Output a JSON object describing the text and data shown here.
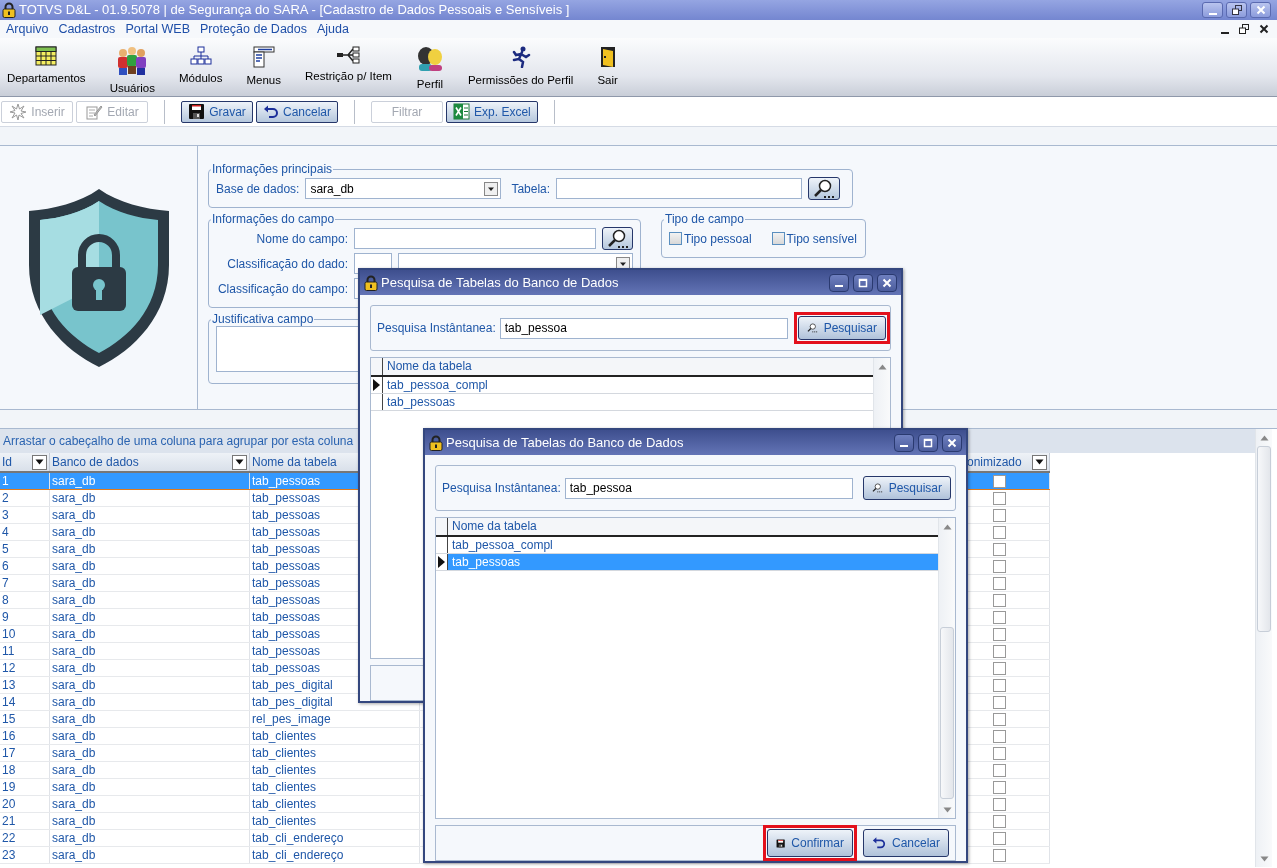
{
  "window": {
    "title": "TOTVS D&L - 01.9.5078 | de Segurança do SARA - [Cadastro de Dados Pessoais e Sensíveis ]"
  },
  "menu": [
    "Arquivo",
    "Cadastros",
    "Portal WEB",
    "Proteção de Dados",
    "Ajuda"
  ],
  "toolbar": [
    "Departamentos",
    "Usuários",
    "Módulos",
    "Menus",
    "Restrição p/ Item",
    "Perfil",
    "Permissões do Perfil",
    "Sair"
  ],
  "action_groups": [
    [
      {
        "label": "Inserir",
        "disabled": true
      },
      {
        "label": "Editar",
        "disabled": true
      }
    ],
    [
      {
        "label": "Gravar",
        "disabled": false
      },
      {
        "label": "Cancelar",
        "disabled": false
      }
    ],
    [
      {
        "label": "Filtrar",
        "disabled": true
      },
      {
        "label": "Exp. Excel",
        "disabled": false
      }
    ]
  ],
  "form": {
    "main": {
      "legend": "Informações principais",
      "database_label": "Base de dados:",
      "database_value": "sara_db",
      "table_label": "Tabela:"
    },
    "field": {
      "legend": "Informações do campo",
      "name_label": "Nome do campo:",
      "data_class_label": "Classificação do dado:",
      "field_class_label": "Classificação do campo:"
    },
    "type": {
      "legend": "Tipo de campo",
      "options": [
        {
          "label": "Tipo pessoal",
          "checked": false
        },
        {
          "label": "Tipo sensível",
          "checked": false
        }
      ]
    },
    "justification": {
      "legend": "Justificativa campo"
    }
  },
  "grid": {
    "group_hint": "Arrastar o cabeçalho de uma coluna para agrupar por esta coluna",
    "columns": [
      "Id",
      "Banco de dados",
      "Nome da tabela",
      "onimizado"
    ],
    "rows": [
      {
        "id": "1",
        "database": "sara_db",
        "table": "tab_pessoas",
        "anonymized": false,
        "selected": true
      },
      {
        "id": "2",
        "database": "sara_db",
        "table": "tab_pessoas",
        "anonymized": false,
        "selected": false
      },
      {
        "id": "3",
        "database": "sara_db",
        "table": "tab_pessoas",
        "anonymized": false,
        "selected": false
      },
      {
        "id": "4",
        "database": "sara_db",
        "table": "tab_pessoas",
        "anonymized": false,
        "selected": false
      },
      {
        "id": "5",
        "database": "sara_db",
        "table": "tab_pessoas",
        "anonymized": false,
        "selected": false
      },
      {
        "id": "6",
        "database": "sara_db",
        "table": "tab_pessoas",
        "anonymized": false,
        "selected": false
      },
      {
        "id": "7",
        "database": "sara_db",
        "table": "tab_pessoas",
        "anonymized": false,
        "selected": false
      },
      {
        "id": "8",
        "database": "sara_db",
        "table": "tab_pessoas",
        "anonymized": false,
        "selected": false
      },
      {
        "id": "9",
        "database": "sara_db",
        "table": "tab_pessoas",
        "anonymized": false,
        "selected": false
      },
      {
        "id": "10",
        "database": "sara_db",
        "table": "tab_pessoas",
        "anonymized": false,
        "selected": false
      },
      {
        "id": "11",
        "database": "sara_db",
        "table": "tab_pessoas",
        "anonymized": false,
        "selected": false
      },
      {
        "id": "12",
        "database": "sara_db",
        "table": "tab_pessoas",
        "anonymized": false,
        "selected": false
      },
      {
        "id": "13",
        "database": "sara_db",
        "table": "tab_pes_digital",
        "anonymized": false,
        "selected": false
      },
      {
        "id": "14",
        "database": "sara_db",
        "table": "tab_pes_digital",
        "anonymized": false,
        "selected": false
      },
      {
        "id": "15",
        "database": "sara_db",
        "table": "rel_pes_image",
        "anonymized": false,
        "selected": false
      },
      {
        "id": "16",
        "database": "sara_db",
        "table": "tab_clientes",
        "anonymized": false,
        "selected": false
      },
      {
        "id": "17",
        "database": "sara_db",
        "table": "tab_clientes",
        "anonymized": false,
        "selected": false
      },
      {
        "id": "18",
        "database": "sara_db",
        "table": "tab_clientes",
        "anonymized": false,
        "selected": false
      },
      {
        "id": "19",
        "database": "sara_db",
        "table": "tab_clientes",
        "anonymized": false,
        "selected": false
      },
      {
        "id": "20",
        "database": "sara_db",
        "table": "tab_clientes",
        "anonymized": false,
        "selected": false
      },
      {
        "id": "21",
        "database": "sara_db",
        "table": "tab_clientes",
        "anonymized": false,
        "selected": false
      },
      {
        "id": "22",
        "database": "sara_db",
        "table": "tab_cli_endereço",
        "anonymized": false,
        "selected": false
      },
      {
        "id": "23",
        "database": "sara_db",
        "table": "tab_cli_endereço",
        "anonymized": false,
        "selected": false
      }
    ]
  },
  "dialogs": [
    {
      "title": "Pesquisa de Tabelas do Banco de Dados",
      "search_label": "Pesquisa Instântanea:",
      "search_value": "tab_pessoa",
      "search_button": {
        "label": "Pesquisar",
        "highlighted": true
      },
      "column": "Nome da tabela",
      "rows": [
        {
          "name": "tab_pessoa_compl",
          "current": true,
          "selected": false
        },
        {
          "name": "tab_pessoas",
          "current": false,
          "selected": false
        }
      ]
    },
    {
      "title": "Pesquisa de Tabelas do Banco de Dados",
      "search_label": "Pesquisa Instântanea:",
      "search_value": "tab_pessoa",
      "search_button": {
        "label": "Pesquisar",
        "highlighted": false
      },
      "column": "Nome da tabela",
      "rows": [
        {
          "name": "tab_pessoa_compl",
          "current": false,
          "selected": false
        },
        {
          "name": "tab_pessoas",
          "current": true,
          "selected": true
        }
      ],
      "buttons": [
        {
          "label": "Confirmar",
          "highlighted": true
        },
        {
          "label": "Cancelar",
          "highlighted": false
        }
      ]
    }
  ]
}
